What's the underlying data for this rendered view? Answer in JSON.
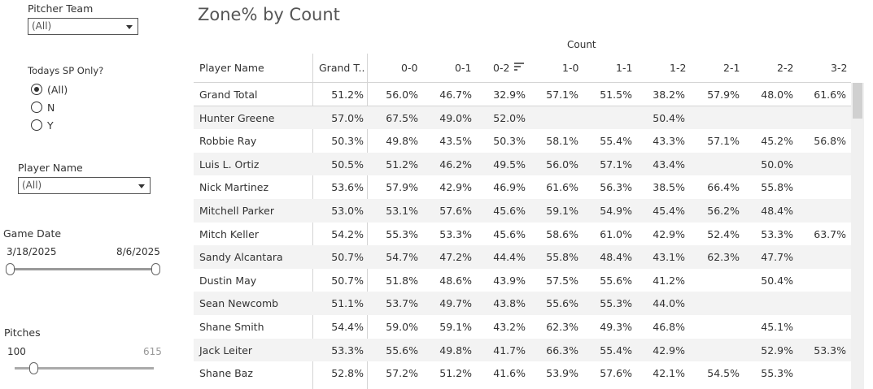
{
  "filters": {
    "pitcher_team": {
      "label": "Pitcher Team",
      "value": "(All)"
    },
    "todays_sp": {
      "label": "Todays SP Only?",
      "options": [
        {
          "label": "(All)",
          "selected": true
        },
        {
          "label": "N",
          "selected": false
        },
        {
          "label": "Y",
          "selected": false
        }
      ]
    },
    "player_name": {
      "label": "Player Name",
      "value": "(All)"
    },
    "game_date": {
      "label": "Game Date",
      "min": "3/18/2025",
      "max": "8/6/2025"
    },
    "pitches": {
      "label": "Pitches",
      "min": "100",
      "max": "615"
    }
  },
  "view": {
    "title": "Zone% by Count",
    "column_group": "Count",
    "columns": [
      "Player Name",
      "Grand T..",
      "0-0",
      "0-1",
      "0-2",
      "1-0",
      "1-1",
      "1-2",
      "2-1",
      "2-2",
      "3-2"
    ],
    "sorted_column": "0-2",
    "rows": [
      [
        "Grand Total",
        "51.2%",
        "56.0%",
        "46.7%",
        "32.9%",
        "57.1%",
        "51.5%",
        "38.2%",
        "57.9%",
        "48.0%",
        "61.6%"
      ],
      [
        "Hunter Greene",
        "57.0%",
        "67.5%",
        "49.0%",
        "52.0%",
        "",
        "",
        "50.4%",
        "",
        "",
        ""
      ],
      [
        "Robbie Ray",
        "50.3%",
        "49.8%",
        "43.5%",
        "50.3%",
        "58.1%",
        "55.4%",
        "43.3%",
        "57.1%",
        "45.2%",
        "56.8%"
      ],
      [
        "Luis L. Ortiz",
        "50.5%",
        "51.2%",
        "46.2%",
        "49.5%",
        "56.0%",
        "57.1%",
        "43.4%",
        "",
        "50.0%",
        ""
      ],
      [
        "Nick Martinez",
        "53.6%",
        "57.9%",
        "42.9%",
        "46.9%",
        "61.6%",
        "56.3%",
        "38.5%",
        "66.4%",
        "55.8%",
        ""
      ],
      [
        "Mitchell Parker",
        "53.0%",
        "53.1%",
        "57.6%",
        "45.6%",
        "59.1%",
        "54.9%",
        "45.4%",
        "56.2%",
        "48.4%",
        ""
      ],
      [
        "Mitch Keller",
        "54.2%",
        "55.3%",
        "53.3%",
        "45.6%",
        "58.6%",
        "61.0%",
        "42.9%",
        "52.4%",
        "53.3%",
        "63.7%"
      ],
      [
        "Sandy Alcantara",
        "50.7%",
        "54.7%",
        "47.2%",
        "44.4%",
        "55.8%",
        "48.4%",
        "43.1%",
        "62.3%",
        "47.7%",
        ""
      ],
      [
        "Dustin May",
        "50.7%",
        "51.8%",
        "48.6%",
        "43.9%",
        "57.5%",
        "55.6%",
        "41.2%",
        "",
        "50.4%",
        ""
      ],
      [
        "Sean Newcomb",
        "51.1%",
        "53.7%",
        "49.7%",
        "43.8%",
        "55.6%",
        "55.3%",
        "44.0%",
        "",
        "",
        ""
      ],
      [
        "Shane Smith",
        "54.4%",
        "59.0%",
        "59.1%",
        "43.2%",
        "62.3%",
        "49.3%",
        "46.8%",
        "",
        "45.1%",
        ""
      ],
      [
        "Jack Leiter",
        "53.3%",
        "55.6%",
        "49.8%",
        "41.7%",
        "66.3%",
        "55.4%",
        "42.9%",
        "",
        "52.9%",
        "53.3%"
      ],
      [
        "Shane Baz",
        "52.8%",
        "57.2%",
        "51.2%",
        "41.6%",
        "53.9%",
        "57.6%",
        "42.1%",
        "54.5%",
        "55.3%",
        ""
      ]
    ]
  }
}
